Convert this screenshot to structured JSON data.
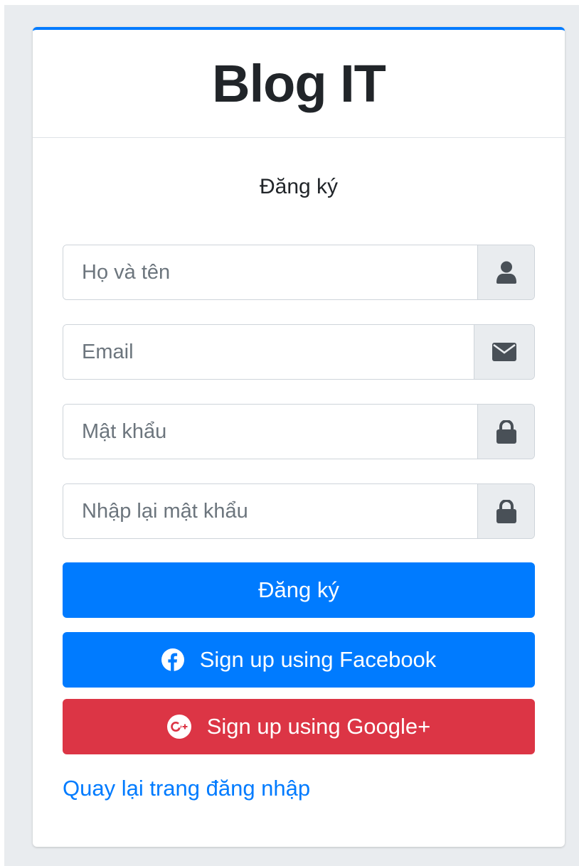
{
  "header": {
    "brand": "Blog IT"
  },
  "form": {
    "title": "Đăng ký",
    "fields": {
      "full_name": {
        "placeholder": "Họ và tên",
        "icon": "user-icon"
      },
      "email": {
        "placeholder": "Email",
        "icon": "envelope-icon"
      },
      "password": {
        "placeholder": "Mật khẩu",
        "icon": "lock-icon"
      },
      "confirm_password": {
        "placeholder": "Nhập lại mật khẩu",
        "icon": "lock-icon"
      }
    },
    "submit_label": "Đăng ký",
    "facebook_label": "Sign up using Facebook",
    "google_label": "Sign up using Google+",
    "back_link": "Quay lại trang đăng nhập"
  },
  "colors": {
    "primary": "#007bff",
    "danger": "#dc3545",
    "addon_bg": "#e9ecef",
    "text": "#212529"
  }
}
